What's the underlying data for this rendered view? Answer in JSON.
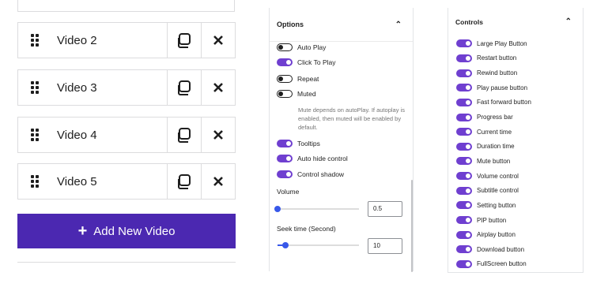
{
  "videos": {
    "items": [
      {
        "label": "Video 2"
      },
      {
        "label": "Video 3"
      },
      {
        "label": "Video 4"
      },
      {
        "label": "Video 5"
      }
    ],
    "add_button_label": "Add New Video"
  },
  "options": {
    "title": "Options",
    "toggles": [
      {
        "label": "Auto Play",
        "on": false
      },
      {
        "label": "Click To Play",
        "on": true
      },
      {
        "label": "Repeat",
        "on": false
      },
      {
        "label": "Muted",
        "on": false
      }
    ],
    "help_text": "Mute depends on autoPlay. If autoplay is enabled, then muted will be enabled by default.",
    "toggles2": [
      {
        "label": "Tooltips",
        "on": true
      },
      {
        "label": "Auto hide control",
        "on": true
      },
      {
        "label": "Control shadow",
        "on": true
      }
    ],
    "volume_label": "Volume",
    "volume_value": "0.5",
    "seek_label": "Seek time (Second)",
    "seek_value": "10"
  },
  "controls": {
    "title": "Controls",
    "items": [
      {
        "label": "Large Play Button",
        "on": true
      },
      {
        "label": "Restart button",
        "on": true
      },
      {
        "label": "Rewind button",
        "on": true
      },
      {
        "label": "Play pause button",
        "on": true
      },
      {
        "label": "Fast forward button",
        "on": true
      },
      {
        "label": "Progress bar",
        "on": true
      },
      {
        "label": "Current time",
        "on": true
      },
      {
        "label": "Duration time",
        "on": true
      },
      {
        "label": "Mute button",
        "on": true
      },
      {
        "label": "Volume control",
        "on": true
      },
      {
        "label": "Subtitle control",
        "on": true
      },
      {
        "label": "Setting button",
        "on": true
      },
      {
        "label": "PIP button",
        "on": true
      },
      {
        "label": "Airplay button",
        "on": true
      },
      {
        "label": "Download button",
        "on": true
      },
      {
        "label": "FullScreen button",
        "on": true
      }
    ]
  },
  "colors": {
    "accent": "#6f3fd0",
    "add_button": "#4b28b1",
    "slider": "#3858e9"
  },
  "icons": {
    "drag": "drag-handle-icon",
    "duplicate": "duplicate-icon",
    "remove": "close-icon",
    "collapse": "chevron-up-icon",
    "add": "plus-icon"
  }
}
